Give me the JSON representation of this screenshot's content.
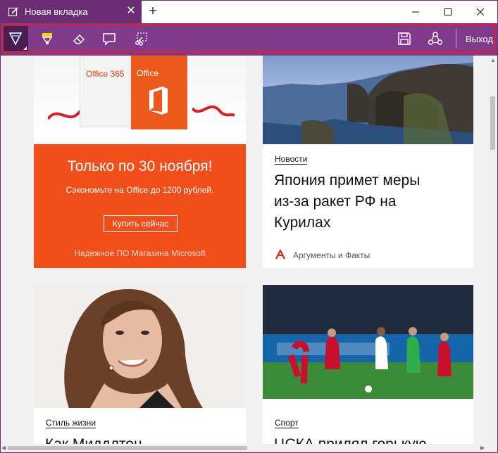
{
  "browser": {
    "tab_title": "Новая вкладка",
    "tab_close": "✕",
    "new_tab": "+",
    "window_controls": {
      "minimize": "minimize-icon",
      "maximize": "maximize-icon",
      "close": "close-icon"
    }
  },
  "toolbar": {
    "tools": [
      "pen-icon",
      "highlighter-icon",
      "eraser-icon",
      "comment-icon",
      "clip-icon"
    ],
    "save": "save-icon",
    "share": "share-icon",
    "exit_label": "Выход",
    "accent": "#7f3a8a",
    "outline_color": "#e0202a"
  },
  "cards": {
    "ad": {
      "box1_label": "Office 365",
      "box2_label": "Office",
      "title": "Только по 30 ноября!",
      "subtitle": "Сэкономьте на Office до 1200 рублей.",
      "button": "Купить сейчас",
      "footer": "Надежное ПО Магазина Microsoft",
      "color": "#f04e1b"
    },
    "news": {
      "category": "Новости",
      "headline_1": "Япония примет меры",
      "headline_2": "из-за ракет РФ на",
      "headline_3": "Курилах",
      "source": "Аргументы и Факты"
    },
    "kate": {
      "category": "Стиль жизни",
      "headline": "Как Миддлтон"
    },
    "sport": {
      "category": "Спорт",
      "headline": "ЦСКА прилял горькую"
    }
  }
}
